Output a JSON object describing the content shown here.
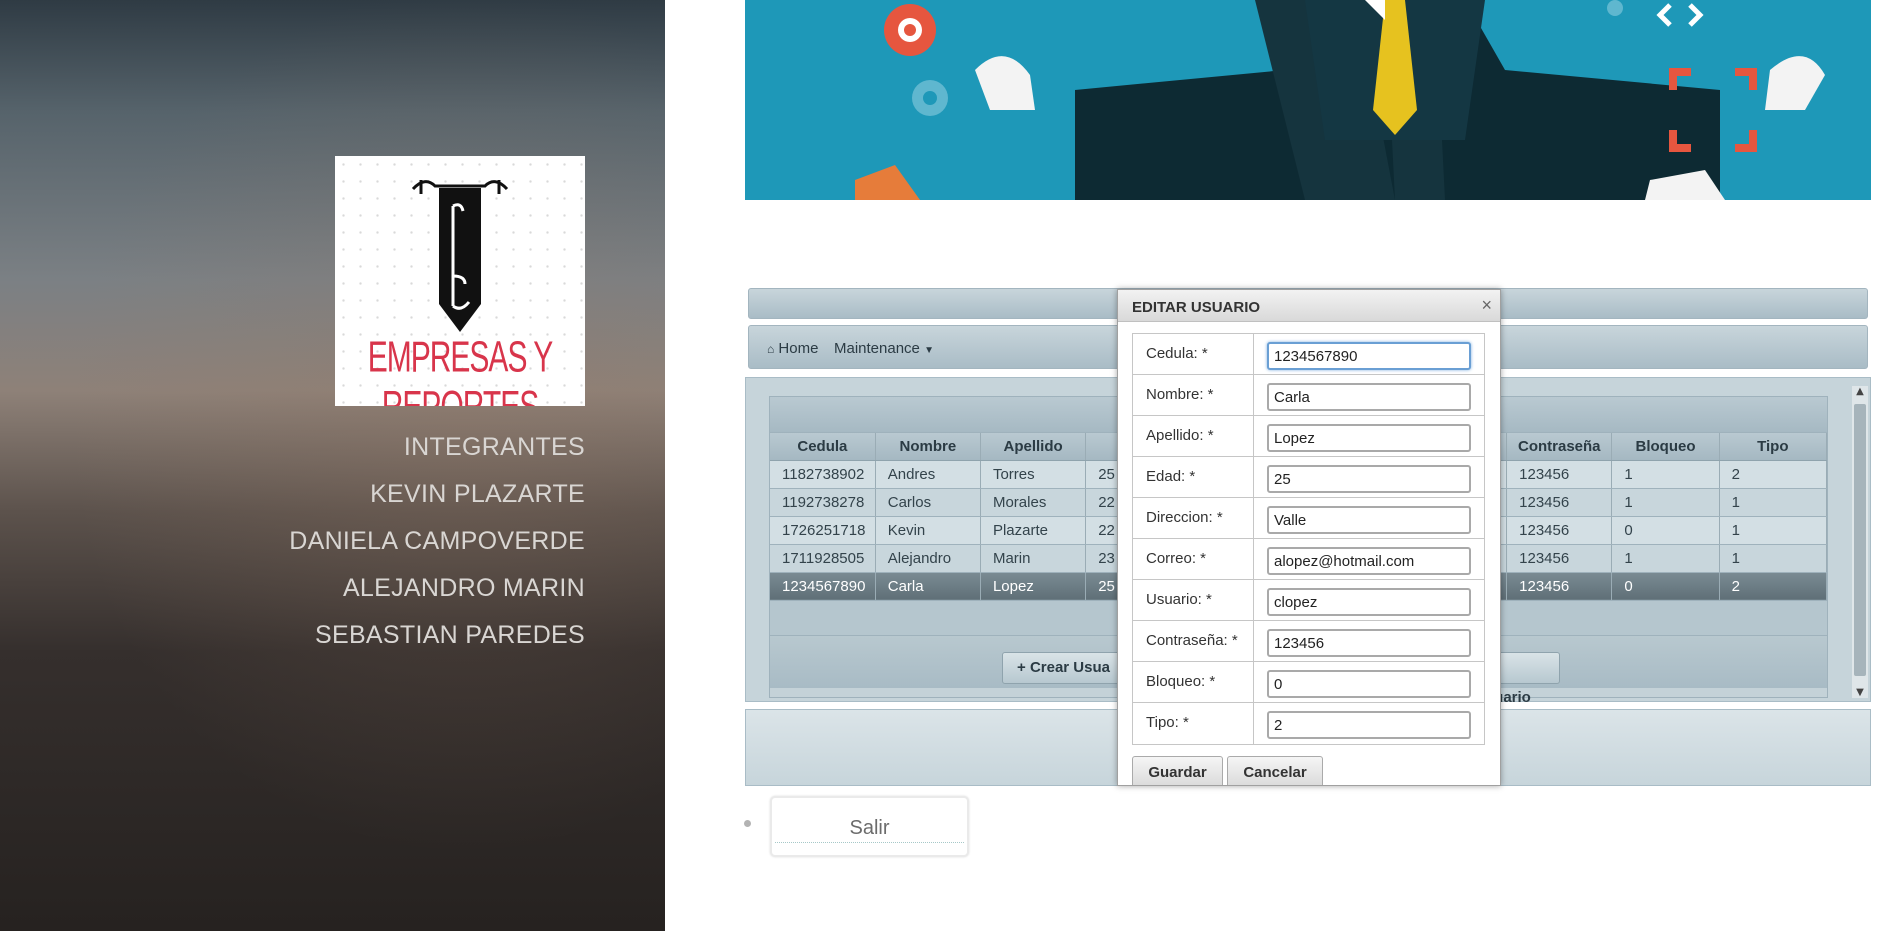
{
  "sidebar": {
    "logo_text": "EMPRESAS Y REPORTES",
    "nav": [
      "INTEGRANTES",
      "KEVIN PLAZARTE",
      "DANIELA CAMPOVERDE",
      "ALEJANDRO MARIN",
      "SEBASTIAN PAREDES"
    ]
  },
  "menubar": {
    "home": "Home",
    "maintenance": "Maintenance"
  },
  "grid": {
    "columns": [
      "Cedula",
      "Nombre",
      "Apellido",
      "",
      "",
      "",
      "",
      "Contraseña",
      "Bloqueo",
      "Tipo"
    ],
    "rows": [
      [
        "1182738902",
        "Andres",
        "Torres",
        "25",
        "123456",
        "1",
        "2"
      ],
      [
        "1192738278",
        "Carlos",
        "Morales",
        "22",
        "123456",
        "1",
        "1"
      ],
      [
        "1726251718",
        "Kevin",
        "Plazarte",
        "22",
        "123456",
        "0",
        "1"
      ],
      [
        "1711928505",
        "Alejandro",
        "Marin",
        "23",
        "123456",
        "1",
        "1"
      ],
      [
        "1234567890",
        "Carla",
        "Lopez",
        "25",
        "123456",
        "0",
        "2"
      ]
    ],
    "selected_row": 4,
    "create_button": "Crear Usua",
    "edit_button": "ar Usuario"
  },
  "dialog": {
    "title": "EDITAR USUARIO",
    "close": "×",
    "fields": [
      {
        "label": "Cedula: *",
        "value": "1234567890"
      },
      {
        "label": "Nombre: *",
        "value": "Carla"
      },
      {
        "label": "Apellido: *",
        "value": "Lopez"
      },
      {
        "label": "Edad: *",
        "value": "25"
      },
      {
        "label": "Direccion: *",
        "value": "Valle"
      },
      {
        "label": "Correo: *",
        "value": "alopez@hotmail.com"
      },
      {
        "label": "Usuario: *",
        "value": "clopez"
      },
      {
        "label": "Contraseña: *",
        "value": "123456"
      },
      {
        "label": "Bloqueo: *",
        "value": "0"
      },
      {
        "label": "Tipo: *",
        "value": "2"
      }
    ],
    "save": "Guardar",
    "cancel": "Cancelar"
  },
  "logout": {
    "label": "Salir"
  },
  "colors": {
    "banner": "#1e98b8",
    "logo_red": "#d8354b",
    "grid_header": "#a9bcc6",
    "selected_row": "#6a7b83"
  },
  "icons": {
    "home": "home-icon",
    "caret": "caret-down-icon",
    "plus": "plus-icon",
    "close": "close-icon"
  }
}
